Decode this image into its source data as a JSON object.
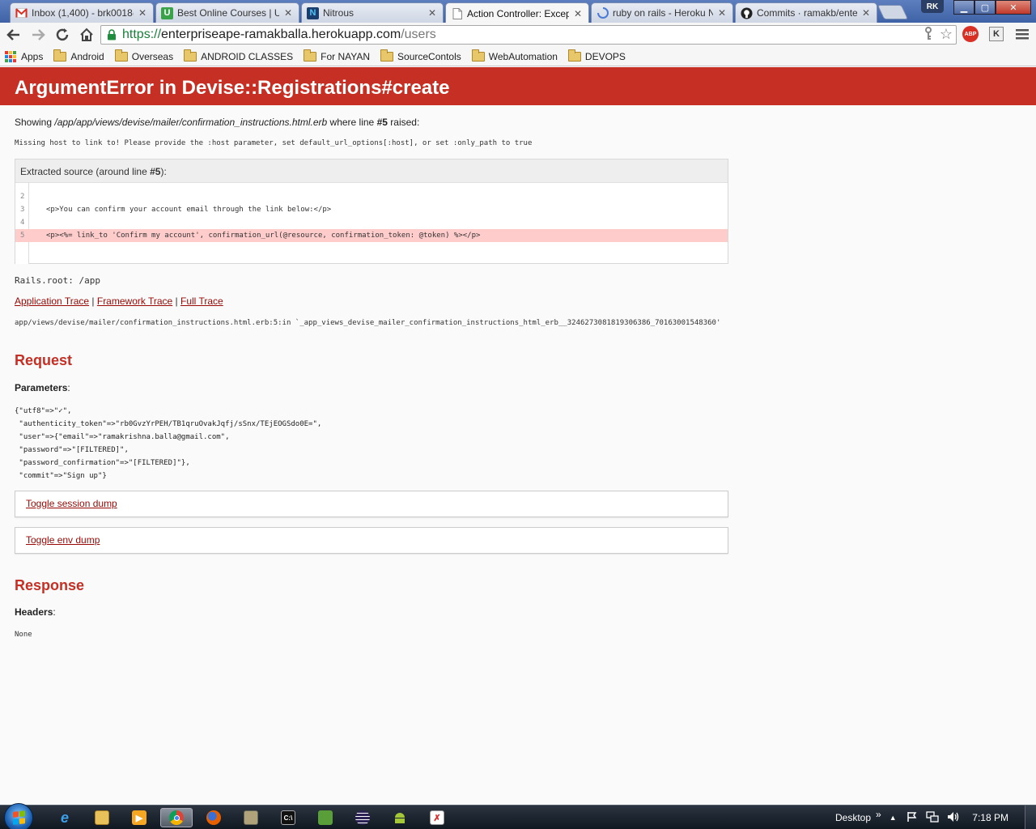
{
  "browser": {
    "tabs": [
      {
        "title": "Inbox (1,400) - brk0018@",
        "icon": "gmail-icon",
        "active": false
      },
      {
        "title": "Best Online Courses | Ud",
        "icon": "udemy-icon",
        "active": false
      },
      {
        "title": "Nitrous",
        "icon": "nitrous-icon",
        "active": false
      },
      {
        "title": "Action Controller: Excep",
        "icon": "page-icon",
        "active": true
      },
      {
        "title": "ruby on rails - Heroku N",
        "icon": "loading-icon",
        "active": false
      },
      {
        "title": "Commits · ramakb/ente",
        "icon": "github-icon",
        "active": false
      }
    ],
    "profile_initials": "RK",
    "url": {
      "scheme": "https://",
      "host": "enterpriseape-ramakballa.herokuapp.com",
      "path": "/users"
    },
    "extensions": {
      "adblock": "ABP",
      "k": "K"
    },
    "bookmarks": [
      {
        "label": "Apps",
        "icon": "apps-grid-icon"
      },
      {
        "label": "Android",
        "icon": "folder-icon"
      },
      {
        "label": "Overseas",
        "icon": "folder-icon"
      },
      {
        "label": "ANDROID CLASSES",
        "icon": "folder-icon"
      },
      {
        "label": "For NAYAN",
        "icon": "folder-icon"
      },
      {
        "label": "SourceContols",
        "icon": "folder-icon"
      },
      {
        "label": "WebAutomation",
        "icon": "folder-icon"
      },
      {
        "label": "DEVOPS",
        "icon": "folder-icon"
      }
    ]
  },
  "error": {
    "title": "ArgumentError in Devise::Registrations#create",
    "showing_prefix": "Showing ",
    "template_path": "/app/app/views/devise/mailer/confirmation_instructions.html.erb",
    "showing_middle": " where line ",
    "line_ref": "#5",
    "showing_suffix": " raised:",
    "message": "Missing host to link to! Please provide the :host parameter, set default_url_options[:host], or set :only_path to true",
    "source_title_prefix": "Extracted source (around line ",
    "source_title_line": "#5",
    "source_title_suffix": "):",
    "source_lines": [
      {
        "num": "2",
        "code": ""
      },
      {
        "num": "3",
        "code": "<p>You can confirm your account email through the link below:</p>"
      },
      {
        "num": "4",
        "code": ""
      },
      {
        "num": "5",
        "code": "<p><%= link_to 'Confirm my account', confirmation_url(@resource, confirmation_token: @token) %></p>"
      }
    ],
    "rails_root": "Rails.root: /app",
    "trace_links": [
      "Application Trace",
      "Framework Trace",
      "Full Trace"
    ],
    "trace_separator": " | ",
    "trace_line": "app/views/devise/mailer/confirmation_instructions.html.erb:5:in `_app_views_devise_mailer_confirmation_instructions_html_erb__3246273081819306386_70163001548360'"
  },
  "request": {
    "heading": "Request",
    "params_label": "Parameters",
    "params_colon": ":",
    "params_lines": [
      "{\"utf8\"=>\"✓\",",
      " \"authenticity_token\"=>\"rb0GvzYrPEH/TB1qruOvakJqfj/sSnx/TEjEOGSdo0E=\",",
      " \"user\"=>{\"email\"=>\"ramakrishna.balla@gmail.com\",",
      " \"password\"=>\"[FILTERED]\",",
      " \"password_confirmation\"=>\"[FILTERED]\"},",
      " \"commit\"=>\"Sign up\"}"
    ],
    "toggle_session": "Toggle session dump",
    "toggle_env": "Toggle env dump"
  },
  "response": {
    "heading": "Response",
    "headers_label": "Headers",
    "headers_colon": ":",
    "headers_value": "None"
  },
  "taskbar": {
    "desktop_label": "Desktop",
    "chevron": "»",
    "time": "7:18 PM"
  },
  "colors": {
    "error_red": "#c52f24",
    "link_red": "#980905",
    "highlight": "#ffcccc"
  }
}
